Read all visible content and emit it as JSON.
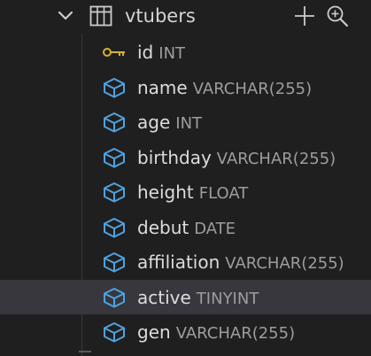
{
  "table": {
    "name": "vtubers",
    "icons": {
      "chevron": "chevron-down-icon",
      "table": "table-icon",
      "add": "add-icon",
      "zoom": "zoom-in-icon"
    }
  },
  "columns": [
    {
      "name": "id",
      "type": "INT",
      "icon": "key-icon"
    },
    {
      "name": "name",
      "type": "VARCHAR(255)",
      "icon": "cube-icon"
    },
    {
      "name": "age",
      "type": "INT",
      "icon": "cube-icon"
    },
    {
      "name": "birthday",
      "type": "VARCHAR(255)",
      "icon": "cube-icon"
    },
    {
      "name": "height",
      "type": "FLOAT",
      "icon": "cube-icon"
    },
    {
      "name": "debut",
      "type": "DATE",
      "icon": "cube-icon"
    },
    {
      "name": "affiliation",
      "type": "VARCHAR(255)",
      "icon": "cube-icon"
    },
    {
      "name": "active",
      "type": "TINYINT",
      "icon": "cube-icon",
      "selected": true
    },
    {
      "name": "gen",
      "type": "VARCHAR(255)",
      "icon": "cube-icon"
    }
  ],
  "colors": {
    "background": "#1f1f1f",
    "selected_row": "#37373d",
    "cube_icon": "#4fa3e0",
    "key_icon": "#d8b03a"
  }
}
